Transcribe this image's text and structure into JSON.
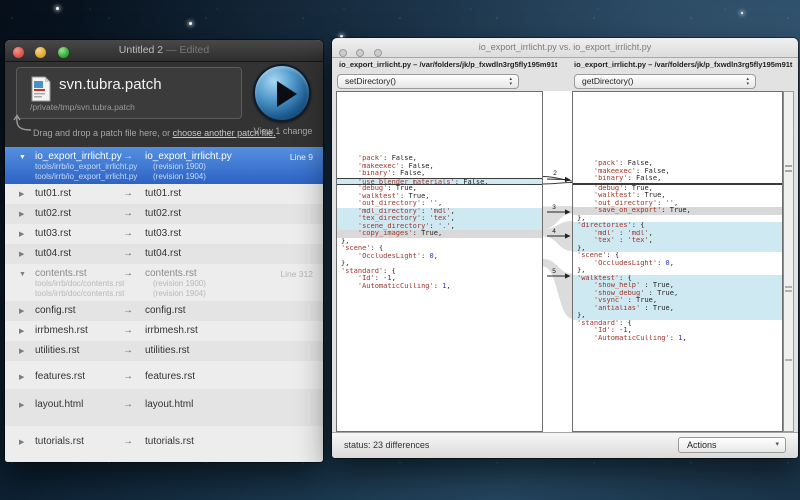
{
  "colors": {
    "selection_blue": "#3875d7",
    "diff_add": "#cfe9f3",
    "diff_chg": "#d9d9d9",
    "code_string": "#9e3428",
    "code_number": "#2731c8"
  },
  "icons": {
    "disclosure_expanded": "▼",
    "disclosure_collapsed": "▶",
    "map_arrow": "→",
    "stepper": "▴\n▾",
    "caret_down": "▾",
    "play": "play-triangle"
  },
  "patch_window": {
    "title": "Untitled 2",
    "title_suffix": " — Edited",
    "patch_name": "svn.tubra.patch",
    "patch_path": "/private/tmp/svn.tubra.patch",
    "drop_hint": "Drag and drop a patch file here, or ",
    "drop_link": "choose another patch file.",
    "view_label": "View 1 change",
    "files": [
      {
        "cls": "exp sel",
        "expanded": true,
        "from": "io_export_irrlicht.py",
        "to": "io_export_irrlicht.py",
        "line": "Line 9",
        "sub": [
          {
            "path": "tools/irrb/io_export_irrlicht.py",
            "rev": "(revision 1900)"
          },
          {
            "path": "tools/irrb/io_export_irrlicht.py",
            "rev": "(revision 1904)"
          }
        ]
      },
      {
        "cls": "",
        "from": "tut01.rst",
        "to": "tut01.rst"
      },
      {
        "cls": "",
        "from": "tut02.rst",
        "to": "tut02.rst"
      },
      {
        "cls": "",
        "from": "tut03.rst",
        "to": "tut03.rst"
      },
      {
        "cls": "",
        "from": "tut04.rst",
        "to": "tut04.rst"
      },
      {
        "cls": "exp dim",
        "expanded": true,
        "from": "contents.rst",
        "to": "contents.rst",
        "line": "Line 312",
        "sub": [
          {
            "path": "tools/irrb/doc/contents.rst",
            "rev": "(revision 1900)"
          },
          {
            "path": "tools/irrb/doc/contents.rst",
            "rev": "(revision 1904)"
          }
        ]
      },
      {
        "cls": "",
        "from": "config.rst",
        "to": "config.rst"
      },
      {
        "cls": "",
        "from": "irrbmesh.rst",
        "to": "irrbmesh.rst"
      },
      {
        "cls": "",
        "from": "utilities.rst",
        "to": "utilities.rst"
      },
      {
        "cls": "mid",
        "from": "features.rst",
        "to": "features.rst"
      },
      {
        "cls": "tall",
        "from": "layout.html",
        "to": "layout.html"
      },
      {
        "cls": "tall",
        "from": "tutorials.rst",
        "to": "tutorials.rst"
      }
    ]
  },
  "diff_window": {
    "title": "io_export_irrlicht.py vs. io_export_irrlicht.py",
    "status": "status: 23 differences",
    "actions_label": "Actions",
    "gutter_numbers": [
      "2",
      "3",
      "4",
      "5"
    ],
    "left": {
      "header": "io_export_irrlicht.py – /var/folders/jk/p_fxwdln3rg5fly195m91t",
      "selector": "setDirectory()",
      "lines": [
        {
          "t": ""
        },
        {
          "t": ""
        },
        {
          "t": ""
        },
        {
          "t": ""
        },
        {
          "t": ""
        },
        {
          "t": ""
        },
        {
          "t": ""
        },
        {
          "t": ""
        },
        {
          "t": "    'pack': False,"
        },
        {
          "t": "    'makeexec': False,"
        },
        {
          "t": "    'binary': False,"
        },
        {
          "t": "    'use_blender_materials': False,",
          "hl": "addb"
        },
        {
          "t": "    'debug': True,"
        },
        {
          "t": "    'walktest': True,"
        },
        {
          "t": "    'out_directory': '',"
        },
        {
          "t": "    'mdl_directory': 'mdl',",
          "hl": "add"
        },
        {
          "t": "    'tex_directory': 'tex',",
          "hl": "add"
        },
        {
          "t": "    'scene_directory': '.',",
          "hl": "add"
        },
        {
          "t": "    'copy_images': True,",
          "hl": "chg"
        },
        {
          "t": "},"
        },
        {
          "t": "'scene': {"
        },
        {
          "t": "    'OccludesLight': 0,"
        },
        {
          "t": "},"
        },
        {
          "t": "'standard': {"
        },
        {
          "t": "    'Id': -1,"
        },
        {
          "t": "    'AutomaticCulling': 1,"
        }
      ]
    },
    "right": {
      "header": "io_export_irrlicht.py – /var/folders/jk/p_fxwdln3rg5fly195m91t",
      "selector": "getDirectory()",
      "lines": [
        {
          "t": ""
        },
        {
          "t": ""
        },
        {
          "t": ""
        },
        {
          "t": ""
        },
        {
          "t": ""
        },
        {
          "t": ""
        },
        {
          "t": ""
        },
        {
          "t": ""
        },
        {
          "t": "    'pack': False,"
        },
        {
          "t": "    'makeexec': False,"
        },
        {
          "t": "    'binary': False,"
        },
        {
          "hl": "rule"
        },
        {
          "t": "    'debug': True,"
        },
        {
          "t": "    'walktest': True,"
        },
        {
          "t": "    'out_directory': '',"
        },
        {
          "t": "    'save_on_export': True,",
          "hl": "chg"
        },
        {
          "t": "},"
        },
        {
          "t": "'directories': {",
          "hl": "add"
        },
        {
          "t": "    'mdl' : 'mdl',",
          "hl": "add"
        },
        {
          "t": "    'tex' : 'tex',",
          "hl": "add"
        },
        {
          "t": "},",
          "hl": "add"
        },
        {
          "t": "'scene': {"
        },
        {
          "t": "    'OccludesLight': 0,"
        },
        {
          "t": "},"
        },
        {
          "t": "'walktest': {",
          "hl": "add"
        },
        {
          "t": "    'show_help' : True,",
          "hl": "add"
        },
        {
          "t": "    'show_debug' : True,",
          "hl": "add"
        },
        {
          "t": "    'vsync' : True,",
          "hl": "add"
        },
        {
          "t": "    'antialias' : True,",
          "hl": "add"
        },
        {
          "t": "},",
          "hl": "add"
        },
        {
          "t": "'standard': {"
        },
        {
          "t": "    'Id': -1,"
        },
        {
          "t": "    'AutomaticCulling': 1,"
        }
      ]
    }
  }
}
